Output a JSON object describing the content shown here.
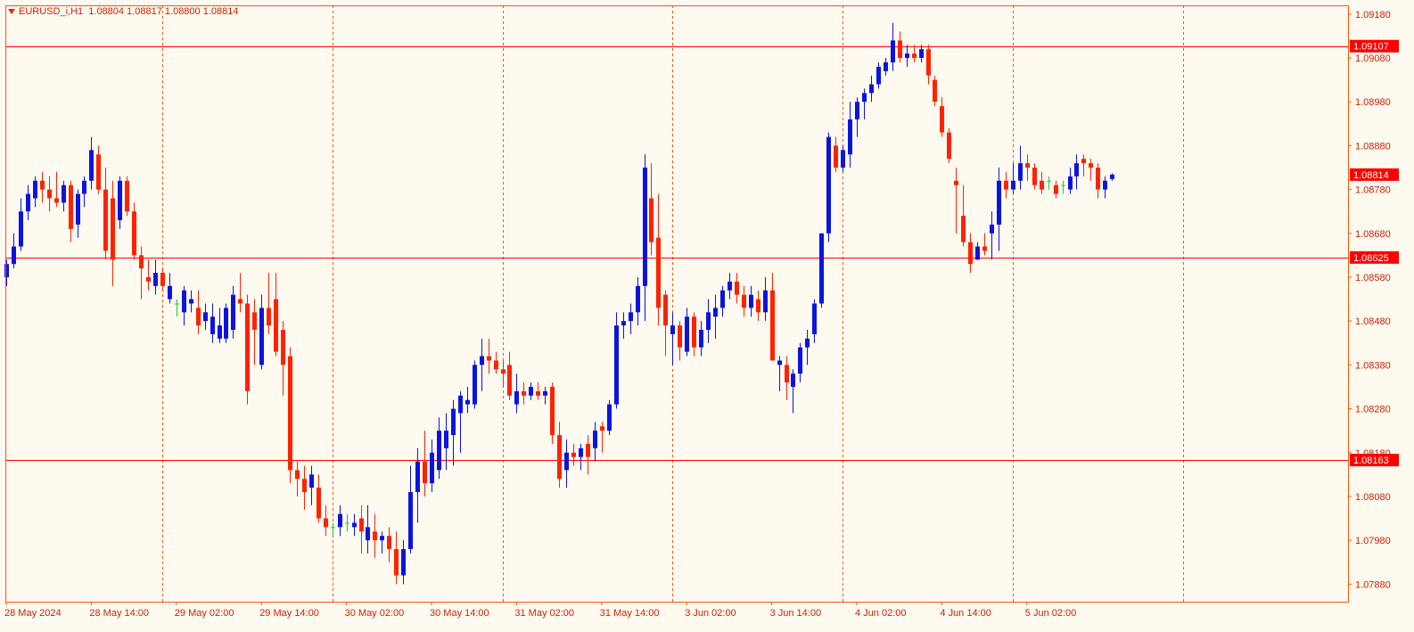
{
  "header": {
    "symbol_label": "EURUSD_i,H1",
    "ohlc_label": "1.08804 1.08817 1.08800 1.08814"
  },
  "colors": {
    "background": "#fffaf0",
    "bull": "#0a14e0",
    "bear": "#ff2200",
    "doji": "#22cc22",
    "grid": "#ff5500",
    "axis_text": "#cc2200",
    "level_line": "#ff0000"
  },
  "chart_data": {
    "type": "candlestick",
    "symbol": "EURUSD_i",
    "timeframe": "H1",
    "ylim": [
      1.0784,
      1.092
    ],
    "y_ticks": [
      "1.09180",
      "1.09080",
      "1.08980",
      "1.08880",
      "1.08780",
      "1.08680",
      "1.08580",
      "1.08480",
      "1.08380",
      "1.08280",
      "1.08180",
      "1.08080",
      "1.07980",
      "1.07880"
    ],
    "x_ticks": [
      {
        "label": "28 May 2024",
        "index": 0
      },
      {
        "label": "28 May 14:00",
        "index": 12
      },
      {
        "label": "29 May 02:00",
        "index": 24
      },
      {
        "label": "29 May 14:00",
        "index": 36
      },
      {
        "label": "30 May 02:00",
        "index": 48
      },
      {
        "label": "30 May 14:00",
        "index": 60
      },
      {
        "label": "31 May 02:00",
        "index": 72
      },
      {
        "label": "31 May 14:00",
        "index": 84
      },
      {
        "label": "3 Jun 02:00",
        "index": 96
      },
      {
        "label": "3 Jun 14:00",
        "index": 108
      },
      {
        "label": "4 Jun 02:00",
        "index": 120
      },
      {
        "label": "4 Jun 14:00",
        "index": 132
      },
      {
        "label": "5 Jun 02:00",
        "index": 144
      }
    ],
    "vertical_separators_at_index": [
      22,
      46,
      70,
      94,
      118,
      142,
      166
    ],
    "grid": false,
    "levels": [
      {
        "label": "1.09107",
        "value": 1.09107
      },
      {
        "label": "1.08625",
        "value": 1.08625
      },
      {
        "label": "1.08163",
        "value": 1.08163
      }
    ],
    "current_price": {
      "label": "1.08814",
      "value": 1.08814
    },
    "ohlc": [
      [
        1.0858,
        1.0862,
        1.0856,
        1.0861
      ],
      [
        1.0861,
        1.0868,
        1.086,
        1.0865
      ],
      [
        1.0865,
        1.0876,
        1.0864,
        1.0873
      ],
      [
        1.0873,
        1.0879,
        1.0871,
        1.0877
      ],
      [
        1.0876,
        1.0881,
        1.0874,
        1.088
      ],
      [
        1.088,
        1.0882,
        1.0875,
        1.0878
      ],
      [
        1.0878,
        1.0881,
        1.0873,
        1.0876
      ],
      [
        1.0876,
        1.0882,
        1.0874,
        1.0875
      ],
      [
        1.0875,
        1.088,
        1.0873,
        1.0879
      ],
      [
        1.0879,
        1.088,
        1.0866,
        1.0869
      ],
      [
        1.087,
        1.0878,
        1.0867,
        1.0877
      ],
      [
        1.0877,
        1.0881,
        1.0874,
        1.088
      ],
      [
        1.088,
        1.089,
        1.0878,
        1.0887
      ],
      [
        1.0886,
        1.0888,
        1.0877,
        1.0878
      ],
      [
        1.0878,
        1.0883,
        1.0862,
        1.0864
      ],
      [
        1.0876,
        1.088,
        1.0856,
        1.0862
      ],
      [
        1.0871,
        1.0881,
        1.0869,
        1.088
      ],
      [
        1.088,
        1.0881,
        1.0872,
        1.0873
      ],
      [
        1.0873,
        1.0875,
        1.0862,
        1.0863
      ],
      [
        1.0863,
        1.0865,
        1.0853,
        1.086
      ],
      [
        1.0858,
        1.0862,
        1.0855,
        1.0857
      ],
      [
        1.0856,
        1.0862,
        1.0854,
        1.0859
      ],
      [
        1.0859,
        1.086,
        1.0855,
        1.0856
      ],
      [
        1.0853,
        1.0859,
        1.0852,
        1.0856
      ],
      [
        1.0852,
        1.0853,
        1.0849,
        1.0852
      ],
      [
        1.085,
        1.0856,
        1.0847,
        1.0855
      ],
      [
        1.0852,
        1.0855,
        1.085,
        1.0853
      ],
      [
        1.0851,
        1.0855,
        1.0845,
        1.0847
      ],
      [
        1.0848,
        1.0852,
        1.0846,
        1.085
      ],
      [
        1.0845,
        1.0852,
        1.0843,
        1.0849
      ],
      [
        1.0844,
        1.0851,
        1.0843,
        1.0847
      ],
      [
        1.0844,
        1.0852,
        1.0843,
        1.0851
      ],
      [
        1.0846,
        1.0856,
        1.0844,
        1.0854
      ],
      [
        1.0853,
        1.0859,
        1.085,
        1.0852
      ],
      [
        1.0852,
        1.0854,
        1.0829,
        1.0832
      ],
      [
        1.085,
        1.0853,
        1.0838,
        1.0846
      ],
      [
        1.0838,
        1.0854,
        1.0837,
        1.0851
      ],
      [
        1.0851,
        1.0859,
        1.0845,
        1.0847
      ],
      [
        1.0853,
        1.0859,
        1.084,
        1.0841
      ],
      [
        1.0846,
        1.0848,
        1.0831,
        1.0838
      ],
      [
        1.084,
        1.0842,
        1.0811,
        1.0814
      ],
      [
        1.0814,
        1.0816,
        1.0808,
        1.0812
      ],
      [
        1.0812,
        1.0815,
        1.0805,
        1.0809
      ],
      [
        1.081,
        1.0815,
        1.0806,
        1.0813
      ],
      [
        1.081,
        1.0813,
        1.0802,
        1.0803
      ],
      [
        1.0803,
        1.0806,
        1.0799,
        1.0801
      ],
      [
        1.0801,
        1.0802,
        1.0799,
        1.0801
      ],
      [
        1.0801,
        1.0806,
        1.0799,
        1.0804
      ],
      [
        1.0802,
        1.0804,
        1.08,
        1.0802
      ],
      [
        1.0801,
        1.0804,
        1.0799,
        1.0802
      ],
      [
        1.0803,
        1.0806,
        1.0795,
        1.08
      ],
      [
        1.0798,
        1.0806,
        1.0795,
        1.0801
      ],
      [
        1.08,
        1.0804,
        1.0794,
        1.0798
      ],
      [
        1.0798,
        1.08,
        1.0795,
        1.0799
      ],
      [
        1.0799,
        1.0801,
        1.0793,
        1.0796
      ],
      [
        1.0796,
        1.08,
        1.0788,
        1.079
      ],
      [
        1.079,
        1.0798,
        1.0788,
        1.0796
      ],
      [
        1.0796,
        1.0815,
        1.0795,
        1.0809
      ],
      [
        1.0809,
        1.0819,
        1.0802,
        1.0816
      ],
      [
        1.0816,
        1.0823,
        1.0808,
        1.0811
      ],
      [
        1.0811,
        1.0821,
        1.0809,
        1.0818
      ],
      [
        1.0814,
        1.0826,
        1.0812,
        1.0823
      ],
      [
        1.0819,
        1.0827,
        1.0814,
        1.0823
      ],
      [
        1.0822,
        1.083,
        1.0815,
        1.0828
      ],
      [
        1.0827,
        1.0832,
        1.0818,
        1.0831
      ],
      [
        1.0829,
        1.0833,
        1.0827,
        1.083
      ],
      [
        1.0829,
        1.0839,
        1.0828,
        1.0838
      ],
      [
        1.0838,
        1.0844,
        1.0832,
        1.084
      ],
      [
        1.084,
        1.0844,
        1.0836,
        1.0839
      ],
      [
        1.0839,
        1.0841,
        1.0836,
        1.0837
      ],
      [
        1.0837,
        1.0839,
        1.0833,
        1.0836
      ],
      [
        1.0838,
        1.0841,
        1.083,
        1.0831
      ],
      [
        1.0829,
        1.0836,
        1.0827,
        1.0832
      ],
      [
        1.0832,
        1.0834,
        1.0829,
        1.0831
      ],
      [
        1.0831,
        1.0834,
        1.083,
        1.0833
      ],
      [
        1.0832,
        1.0834,
        1.083,
        1.0831
      ],
      [
        1.0831,
        1.0833,
        1.0829,
        1.0832
      ],
      [
        1.0833,
        1.0834,
        1.082,
        1.0822
      ],
      [
        1.0822,
        1.0825,
        1.081,
        1.0812
      ],
      [
        1.0814,
        1.0821,
        1.081,
        1.0818
      ],
      [
        1.0818,
        1.082,
        1.0815,
        1.0817
      ],
      [
        1.0817,
        1.082,
        1.0814,
        1.0819
      ],
      [
        1.082,
        1.0822,
        1.0813,
        1.0817
      ],
      [
        1.0819,
        1.0825,
        1.0816,
        1.0823
      ],
      [
        1.0824,
        1.0825,
        1.0818,
        1.0823
      ],
      [
        1.0823,
        1.083,
        1.0822,
        1.0829
      ],
      [
        1.0829,
        1.085,
        1.0828,
        1.0847
      ],
      [
        1.0847,
        1.085,
        1.0844,
        1.0848
      ],
      [
        1.0848,
        1.0852,
        1.0845,
        1.085
      ],
      [
        1.085,
        1.0858,
        1.0847,
        1.0856
      ],
      [
        1.0856,
        1.0886,
        1.0848,
        1.0883
      ],
      [
        1.0876,
        1.0884,
        1.0863,
        1.0866
      ],
      [
        1.0867,
        1.0877,
        1.0847,
        1.0851
      ],
      [
        1.0854,
        1.0855,
        1.084,
        1.0847
      ],
      [
        1.0845,
        1.085,
        1.0838,
        1.0847
      ],
      [
        1.0847,
        1.0848,
        1.0839,
        1.0842
      ],
      [
        1.0841,
        1.0851,
        1.084,
        1.0849
      ],
      [
        1.0849,
        1.085,
        1.084,
        1.0842
      ],
      [
        1.0842,
        1.0848,
        1.084,
        1.0846
      ],
      [
        1.0846,
        1.0853,
        1.0843,
        1.085
      ],
      [
        1.0849,
        1.0854,
        1.0844,
        1.0851
      ],
      [
        1.0851,
        1.0856,
        1.0849,
        1.0855
      ],
      [
        1.0855,
        1.0859,
        1.0853,
        1.0857
      ],
      [
        1.0857,
        1.0859,
        1.0852,
        1.0854
      ],
      [
        1.0854,
        1.0856,
        1.0849,
        1.0851
      ],
      [
        1.0851,
        1.0856,
        1.0849,
        1.0854
      ],
      [
        1.0853,
        1.0855,
        1.0848,
        1.085
      ],
      [
        1.085,
        1.0858,
        1.0848,
        1.0855
      ],
      [
        1.0855,
        1.0859,
        1.0846,
        1.0839
      ],
      [
        1.0838,
        1.084,
        1.0832,
        1.0839
      ],
      [
        1.0838,
        1.084,
        1.083,
        1.0834
      ],
      [
        1.0833,
        1.0837,
        1.0827,
        1.0836
      ],
      [
        1.0836,
        1.0843,
        1.0834,
        1.0842
      ],
      [
        1.0842,
        1.0846,
        1.0838,
        1.0844
      ],
      [
        1.0845,
        1.0853,
        1.0843,
        1.0852
      ],
      [
        1.0852,
        1.0861,
        1.0851,
        1.0868
      ],
      [
        1.0868,
        1.0891,
        1.0866,
        1.089
      ],
      [
        1.0888,
        1.089,
        1.0882,
        1.0883
      ],
      [
        1.0883,
        1.0888,
        1.0882,
        1.0887
      ],
      [
        1.0886,
        1.0898,
        1.0883,
        1.0894
      ],
      [
        1.0894,
        1.0899,
        1.089,
        1.0898
      ],
      [
        1.0898,
        1.0901,
        1.0894,
        1.09
      ],
      [
        1.09,
        1.0904,
        1.0898,
        1.0902
      ],
      [
        1.0902,
        1.0907,
        1.0901,
        1.0906
      ],
      [
        1.0905,
        1.0908,
        1.0904,
        1.0907
      ],
      [
        1.0907,
        1.0916,
        1.0905,
        1.0912
      ],
      [
        1.0912,
        1.0914,
        1.0907,
        1.0908
      ],
      [
        1.0908,
        1.0911,
        1.0906,
        1.0909
      ],
      [
        1.0909,
        1.0911,
        1.0907,
        1.0908
      ],
      [
        1.0908,
        1.0911,
        1.0907,
        1.091
      ],
      [
        1.091,
        1.0911,
        1.0902,
        1.0904
      ],
      [
        1.0903,
        1.0904,
        1.0897,
        1.0898
      ],
      [
        1.0897,
        1.0899,
        1.089,
        1.0891
      ],
      [
        1.0891,
        1.0892,
        1.0884,
        1.0885
      ],
      [
        1.088,
        1.0883,
        1.0868,
        1.0879
      ],
      [
        1.0872,
        1.0879,
        1.0865,
        1.0866
      ],
      [
        1.0866,
        1.0868,
        1.0859,
        1.0861
      ],
      [
        1.0862,
        1.0866,
        1.0862,
        1.0865
      ],
      [
        1.0865,
        1.0868,
        1.0863,
        1.0864
      ],
      [
        1.0868,
        1.0873,
        1.0862,
        1.087
      ],
      [
        1.087,
        1.0883,
        1.0864,
        1.088
      ],
      [
        1.088,
        1.0882,
        1.0876,
        1.0878
      ],
      [
        1.0878,
        1.0884,
        1.0877,
        1.088
      ],
      [
        1.088,
        1.0888,
        1.0878,
        1.0884
      ],
      [
        1.0884,
        1.0886,
        1.088,
        1.0883
      ],
      [
        1.0883,
        1.0884,
        1.0878,
        1.0879
      ],
      [
        1.088,
        1.0882,
        1.0877,
        1.0878
      ],
      [
        1.088,
        1.0881,
        1.0878,
        1.088
      ],
      [
        1.0879,
        1.088,
        1.0876,
        1.0877
      ],
      [
        1.0879,
        1.088,
        1.0877,
        1.0879
      ],
      [
        1.0878,
        1.0883,
        1.0877,
        1.0881
      ],
      [
        1.0881,
        1.0886,
        1.0878,
        1.0884
      ],
      [
        1.0885,
        1.0886,
        1.0881,
        1.0884
      ],
      [
        1.0884,
        1.0885,
        1.088,
        1.0883
      ],
      [
        1.0883,
        1.0884,
        1.0876,
        1.0878
      ],
      [
        1.0878,
        1.0881,
        1.0876,
        1.088
      ],
      [
        1.08804,
        1.08817,
        1.088,
        1.08814
      ]
    ]
  }
}
